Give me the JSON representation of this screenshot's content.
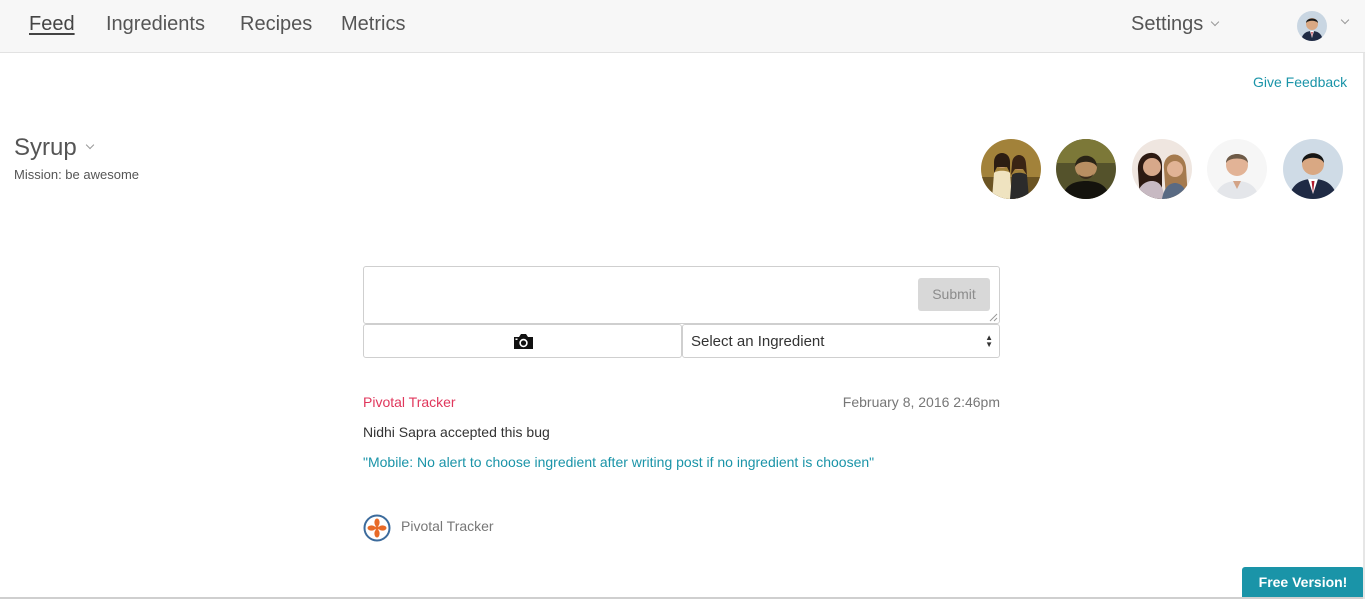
{
  "nav": {
    "items": [
      {
        "label": "Feed",
        "active": true
      },
      {
        "label": "Ingredients",
        "active": false
      },
      {
        "label": "Recipes",
        "active": false
      },
      {
        "label": "Metrics",
        "active": false
      }
    ],
    "settings_label": "Settings"
  },
  "header": {
    "feedback_label": "Give Feedback"
  },
  "team": {
    "name": "Syrup",
    "mission": "Mission: be awesome",
    "member_count_shown": 5
  },
  "composer": {
    "text_value": "",
    "submit_label": "Submit",
    "photo_icon": "camera-icon",
    "ingredient_select": "Select an Ingredient"
  },
  "feed": {
    "items": [
      {
        "source": "Pivotal Tracker",
        "timestamp": "February 8, 2016 2:46pm",
        "text": "Nidhi Sapra accepted this bug",
        "link": "\"Mobile: No alert to choose ingredient after writing post if no ingredient is choosen\"",
        "footer_label": "Pivotal Tracker"
      }
    ]
  },
  "promo": {
    "label": "Free Version!"
  },
  "colors": {
    "accent": "#1a94a8",
    "source_red": "#e0375c",
    "topbar_bg": "#f7f7f7"
  }
}
